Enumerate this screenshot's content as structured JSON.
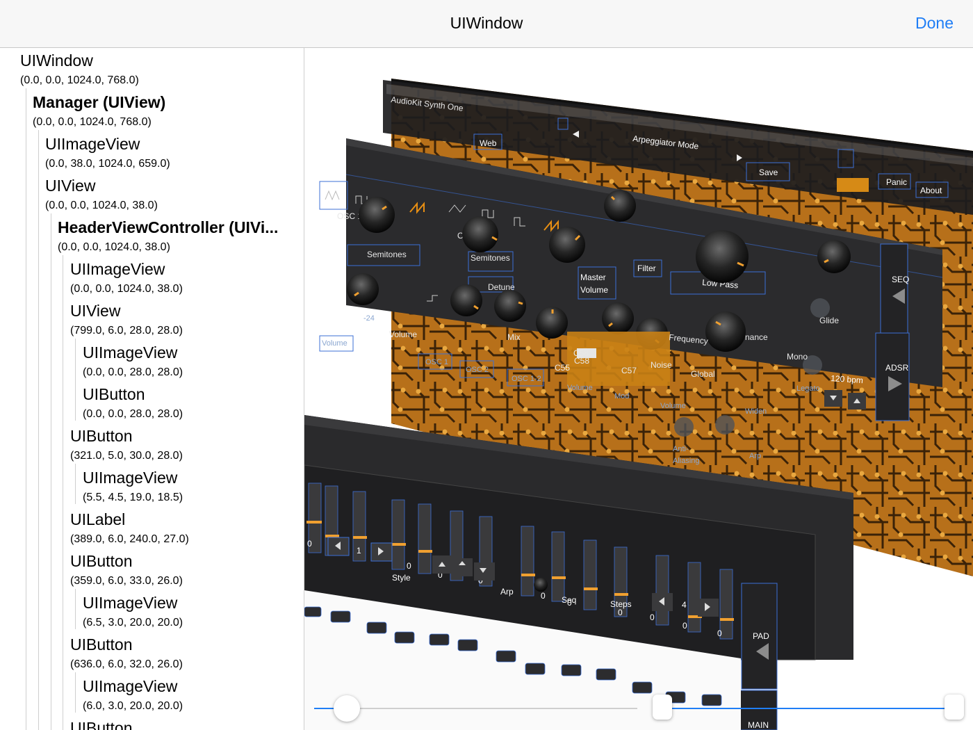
{
  "navbar": {
    "title": "UIWindow",
    "done_label": "Done"
  },
  "tree": {
    "nodes": [
      {
        "name": "UIWindow",
        "frame": "(0.0, 0.0, 1024.0, 768.0)"
      },
      {
        "name": "Manager (UIView)",
        "frame": "(0.0, 0.0, 1024.0, 768.0)"
      },
      {
        "name": "UIImageView",
        "frame": "(0.0, 38.0, 1024.0, 659.0)"
      },
      {
        "name": "UIView",
        "frame": "(0.0, 0.0, 1024.0, 38.0)"
      },
      {
        "name": "HeaderViewController (UIVi...",
        "frame": "(0.0, 0.0, 1024.0, 38.0)"
      },
      {
        "name": "UIImageView",
        "frame": "(0.0, 0.0, 1024.0, 38.0)"
      },
      {
        "name": "UIView",
        "frame": "(799.0, 6.0, 28.0, 28.0)"
      },
      {
        "name": "UIImageView",
        "frame": "(0.0, 0.0, 28.0, 28.0)"
      },
      {
        "name": "UIButton",
        "frame": "(0.0, 0.0, 28.0, 28.0)"
      },
      {
        "name": "UIButton",
        "frame": "(321.0, 5.0, 30.0, 28.0)"
      },
      {
        "name": "UIImageView",
        "frame": "(5.5, 4.5, 19.0, 18.5)"
      },
      {
        "name": "UILabel",
        "frame": "(389.0, 6.0, 240.0, 27.0)"
      },
      {
        "name": "UIButton",
        "frame": "(359.0, 6.0, 33.0, 26.0)"
      },
      {
        "name": "UIImageView",
        "frame": "(6.5, 3.0, 20.0, 20.0)"
      },
      {
        "name": "UIButton",
        "frame": "(636.0, 6.0, 32.0, 26.0)"
      },
      {
        "name": "UIImageView",
        "frame": "(6.0, 3.0, 20.0, 20.0)"
      },
      {
        "name": "UIButton",
        "frame": ""
      }
    ]
  },
  "scene": {
    "title_label": "AudioKit Synth One",
    "header": {
      "web": "Web",
      "arp_mode": "Arpeggiator Mode",
      "save": "Save",
      "panic": "Panic",
      "about": "About"
    },
    "osc_panel": {
      "osc1": "OSC 1",
      "osc2": "OSC 2",
      "semitones_1": "Semitones",
      "semitones_2": "Semitones",
      "master_line1": "Master",
      "master_line2": "Volume",
      "filter": "Filter",
      "low_pass": "Low Pass",
      "seq": "SEQ",
      "detune": "Detune",
      "glide": "Glide",
      "minus24": "-24",
      "volume": "Volume",
      "volume_small": "Volume"
    },
    "mixer_panel": {
      "mix": "Mix",
      "frequency": "Frequency",
      "resonance": "nance",
      "noise": "Noise",
      "global": "Global",
      "osc1": "OSC 1",
      "osc2": "OSC 2",
      "osc12": "OSC 1-2",
      "volume": "Volume",
      "mod": "Mod",
      "volume2": "Volume",
      "mono": "Mono",
      "legato": "Legato",
      "bpm": "120 bpm",
      "widen": "Widen",
      "arp": "Arp",
      "anti_line1": "Anti-",
      "anti_line2": "Aliasing",
      "adsr": "ADSR",
      "chips": [
        "C58",
        "C55",
        "C57",
        "C58"
      ]
    },
    "seq_panel": {
      "style": "Style",
      "arp": "Arp",
      "seq": "Seq",
      "steps": "Steps",
      "pad": "PAD",
      "main": "MAIN",
      "values": [
        "0",
        "1",
        "0",
        "0",
        "0",
        "0",
        "4",
        "0",
        "0",
        "0",
        "0",
        "0"
      ]
    }
  },
  "sliders": {
    "depth": 0.05,
    "range_low": 0.0,
    "range_high": 1.0
  },
  "colors": {
    "accent": "#1f7ef6",
    "orange": "#f0a030",
    "panel": "#2b2b2d",
    "board": "#c77a18"
  }
}
